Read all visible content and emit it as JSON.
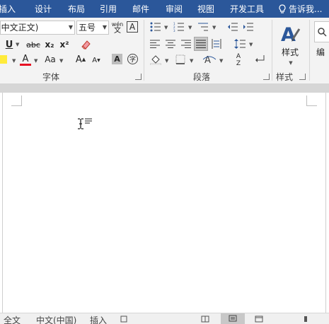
{
  "tabs": [
    "插入",
    "设计",
    "布局",
    "引用",
    "邮件",
    "审阅",
    "视图",
    "开发工具"
  ],
  "tell_me": "告诉我...",
  "font": {
    "name": "(中文正文)",
    "size": "五号",
    "phonetic_top": "wén",
    "phonetic_bottom": "文",
    "border_char": "A",
    "underline": "U",
    "strike": "abc",
    "subscript": "x₂",
    "superscript": "x²",
    "color_a": "A",
    "case": "Aa",
    "grow": "A",
    "shrink": "A",
    "shading_a": "A",
    "enclose": "字",
    "group_label": "字体"
  },
  "paragraph": {
    "group_label": "段落",
    "sort_a": "A",
    "sort_z": "Z"
  },
  "styles": {
    "label": "样式",
    "group_label": "样式",
    "edit_partial": "编"
  },
  "status": {
    "items": [
      "全文",
      "中文(中国)",
      "插入"
    ]
  },
  "colors": {
    "tab_bar": "#2b579a",
    "font_color": "#e81123",
    "highlight": "#ffeb3b",
    "accent_blue": "#2b579a"
  }
}
